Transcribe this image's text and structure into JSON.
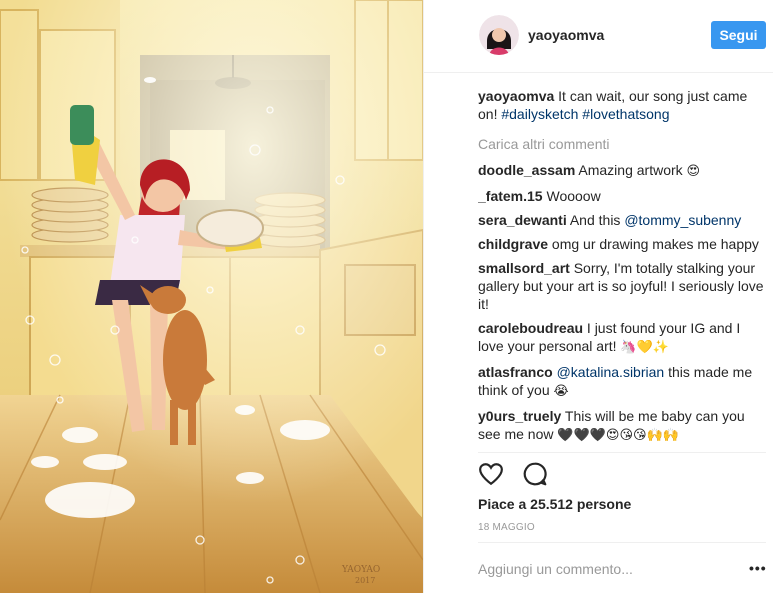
{
  "post": {
    "username": "yaoyaomva",
    "follow_label": "Segui",
    "caption_user": "yaoyaomva",
    "caption_text": "It can wait, our song just came on!",
    "caption_tags": [
      "#dailysketch",
      "#lovethatsong"
    ],
    "load_more_label": "Carica altri commenti",
    "likes_label": "Piace a 25.512 persone",
    "date_label": "18 MAGGIO",
    "add_comment_placeholder": "Aggiungi un commento...",
    "more_label": "•••",
    "artist_signature": "YAOYAO 2017"
  },
  "comments": [
    {
      "user": "doodle_assam",
      "text": "Amazing artwork",
      "emoji": "😍"
    },
    {
      "user": "_fatem.15",
      "text": "Woooow",
      "emoji": ""
    },
    {
      "user": "sera_dewanti",
      "text": "And this",
      "mention": "@tommy_subenny"
    },
    {
      "user": "childgrave",
      "text": "omg ur drawing makes me happy",
      "emoji": ""
    },
    {
      "user": "smallsord_art",
      "text": "Sorry, I'm totally stalking your gallery but your art is so joyful! I seriously love it!",
      "emoji": ""
    },
    {
      "user": "caroleboudreau",
      "text": "I just found your IG and I love your personal art!",
      "emoji": "🦄💛✨"
    },
    {
      "user": "atlasfranco",
      "mention": "@katalina.sibrian",
      "text2": "this made me think of you",
      "emoji": "😭"
    },
    {
      "user": "y0urs_truely",
      "text": "This will be me baby can you see me now",
      "emoji": "🖤🖤🖤😍😘😘🙌🙌"
    }
  ],
  "icons": {
    "like": "heart-icon",
    "comment": "comment-icon"
  },
  "colors": {
    "follow_button": "#3897f0",
    "tag": "#003569",
    "muted": "#999999"
  }
}
